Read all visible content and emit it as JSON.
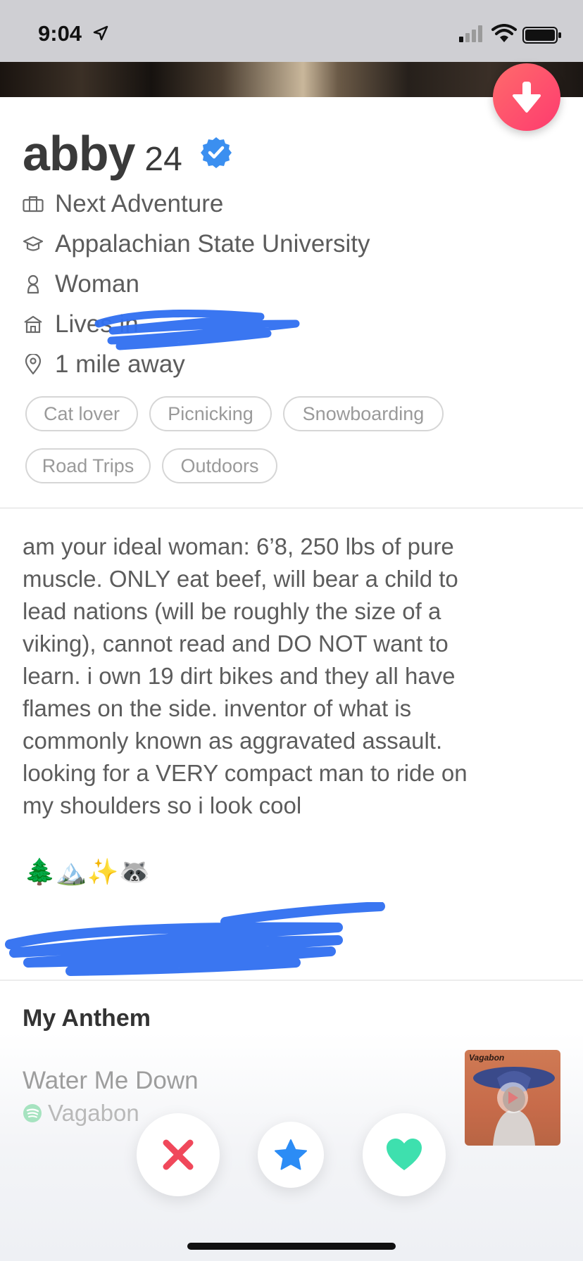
{
  "status_bar": {
    "time": "9:04"
  },
  "profile": {
    "name": "abby",
    "age": "24",
    "job": "Next Adventure",
    "school": "Appalachian State University",
    "gender": "Woman",
    "lives_in": "Lives in",
    "distance": "1 mile away"
  },
  "interests": [
    "Cat lover",
    "Picnicking",
    "Snowboarding",
    "Road Trips",
    "Outdoors"
  ],
  "bio": {
    "lines": [
      "am your ideal woman: 6’8, 250 lbs of pure",
      "muscle. ONLY eat beef, will bear a child to",
      "lead nations (will be roughly the size of a",
      "viking), cannot read and DO NOT want to",
      "learn. i own 19 dirt bikes and they all have",
      "flames on the side. inventor of what is",
      "commonly known as aggravated assault.",
      "looking for a VERY compact man to ride on",
      "my shoulders so i look cool"
    ],
    "emojis": "🌲🏔️✨🦝"
  },
  "anthem": {
    "section_title": "My Anthem",
    "song": "Water Me Down",
    "artist": "Vagabon",
    "album_label": "Vagabon"
  },
  "colors": {
    "nope": "#f0485b",
    "super_like": "#2c8cf5",
    "like": "#3ee0ae",
    "verified": "#3b8ff0",
    "collapse_gradient_start": "#ff6b6b",
    "collapse_gradient_end": "#fd3b6f",
    "redaction": "#2f6ff0",
    "spotify": "#a6e3c0"
  },
  "icons": {
    "collapse": "arrow-down-icon",
    "verified": "verified-check-icon",
    "job": "briefcase-icon",
    "school": "graduation-cap-icon",
    "gender": "person-icon",
    "lives": "house-icon",
    "distance": "location-pin-icon",
    "nope": "x-icon",
    "super_like": "star-icon",
    "like": "heart-icon",
    "spotify": "spotify-icon",
    "play": "play-icon"
  }
}
